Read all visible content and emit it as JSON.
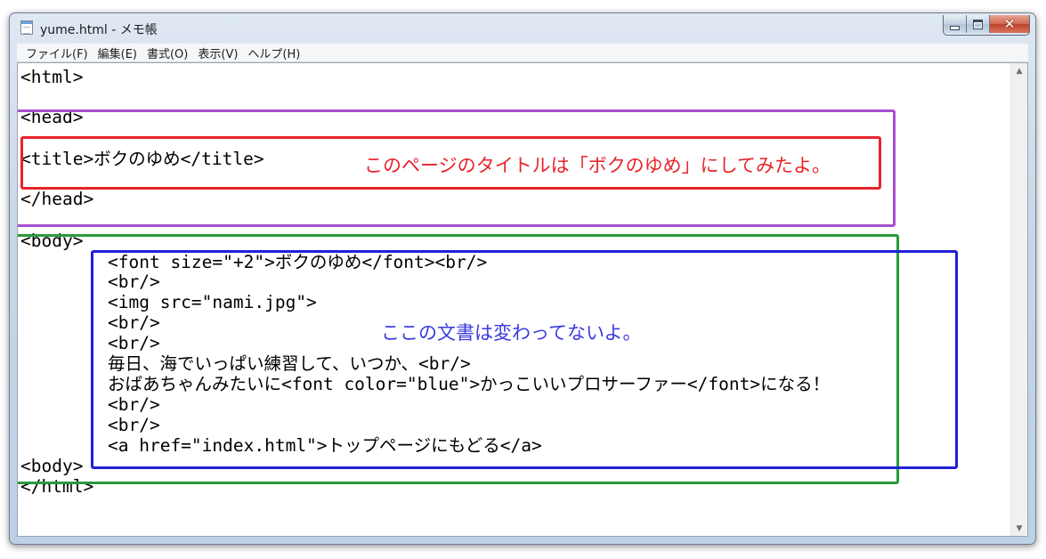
{
  "window": {
    "title": "yume.html - メモ帳"
  },
  "menubar": {
    "items": [
      {
        "label": "ファイル(F)"
      },
      {
        "label": "編集(E)"
      },
      {
        "label": "書式(O)"
      },
      {
        "label": "表示(V)"
      },
      {
        "label": "ヘルプ(H)"
      }
    ]
  },
  "editor": {
    "lines": [
      "<html>",
      "",
      "<head>",
      "",
      "<title>ボクのゆめ</title>",
      "",
      "</head>",
      "",
      "<body>",
      "<font size=\"+2\">ボクのゆめ</font><br/>",
      "<br/>",
      "<img src=\"nami.jpg\">",
      "<br/>",
      "<br/>",
      "毎日、海でいっぱい練習して、いつか、<br/>",
      "おばあちゃんみたいに<font color=\"blue\">かっこいいプロサーファー</font>になる！",
      "<br/>",
      "<br/>",
      "<a href=\"index.html\">トップページにもどる</a>",
      "<body>",
      "</html>"
    ]
  },
  "annotations": {
    "title_note": "このページのタイトルは「ボクのゆめ」にしてみたよ。",
    "body_note": "ここの文書は変わってないよ。"
  },
  "colors": {
    "purple": "#a94fd0",
    "red": "#e8232a",
    "green": "#2a9a3a",
    "blue": "#2020d8",
    "red_text": "#e8232a",
    "blue_text": "#3a3ae0"
  }
}
